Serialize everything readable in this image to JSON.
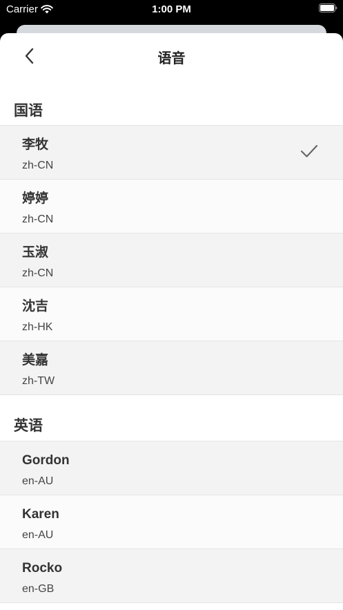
{
  "status_bar": {
    "carrier": "Carrier",
    "time": "1:00 PM"
  },
  "nav": {
    "title": "语音",
    "back_icon": "chevron-left-icon"
  },
  "sections": [
    {
      "title": "国语",
      "voices": [
        {
          "name": "李牧",
          "locale": "zh-CN",
          "selected": true
        },
        {
          "name": "婷婷",
          "locale": "zh-CN",
          "selected": false
        },
        {
          "name": "玉淑",
          "locale": "zh-CN",
          "selected": false
        },
        {
          "name": "沈吉",
          "locale": "zh-HK",
          "selected": false
        },
        {
          "name": "美嘉",
          "locale": "zh-TW",
          "selected": false
        }
      ]
    },
    {
      "title": "英语",
      "voices": [
        {
          "name": "Gordon",
          "locale": "en-AU",
          "selected": false
        },
        {
          "name": "Karen",
          "locale": "en-AU",
          "selected": false
        },
        {
          "name": "Rocko",
          "locale": "en-GB",
          "selected": false
        }
      ]
    }
  ],
  "colors": {
    "row_shaded": "#f3f3f3",
    "row_light": "#fbfbfb",
    "divider": "#e4e4e4",
    "check": "#666666"
  }
}
